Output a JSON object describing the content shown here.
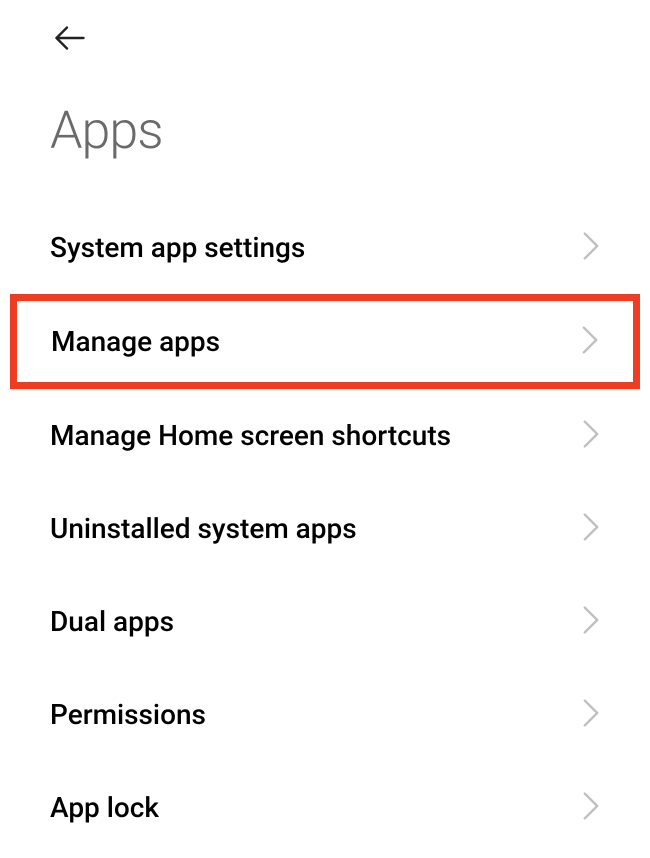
{
  "header": {
    "title": "Apps"
  },
  "list": {
    "items": [
      {
        "label": "System app settings",
        "highlighted": false
      },
      {
        "label": "Manage apps",
        "highlighted": true
      },
      {
        "label": "Manage Home screen shortcuts",
        "highlighted": false
      },
      {
        "label": "Uninstalled system apps",
        "highlighted": false
      },
      {
        "label": "Dual apps",
        "highlighted": false
      },
      {
        "label": "Permissions",
        "highlighted": false
      },
      {
        "label": "App lock",
        "highlighted": false
      }
    ]
  }
}
